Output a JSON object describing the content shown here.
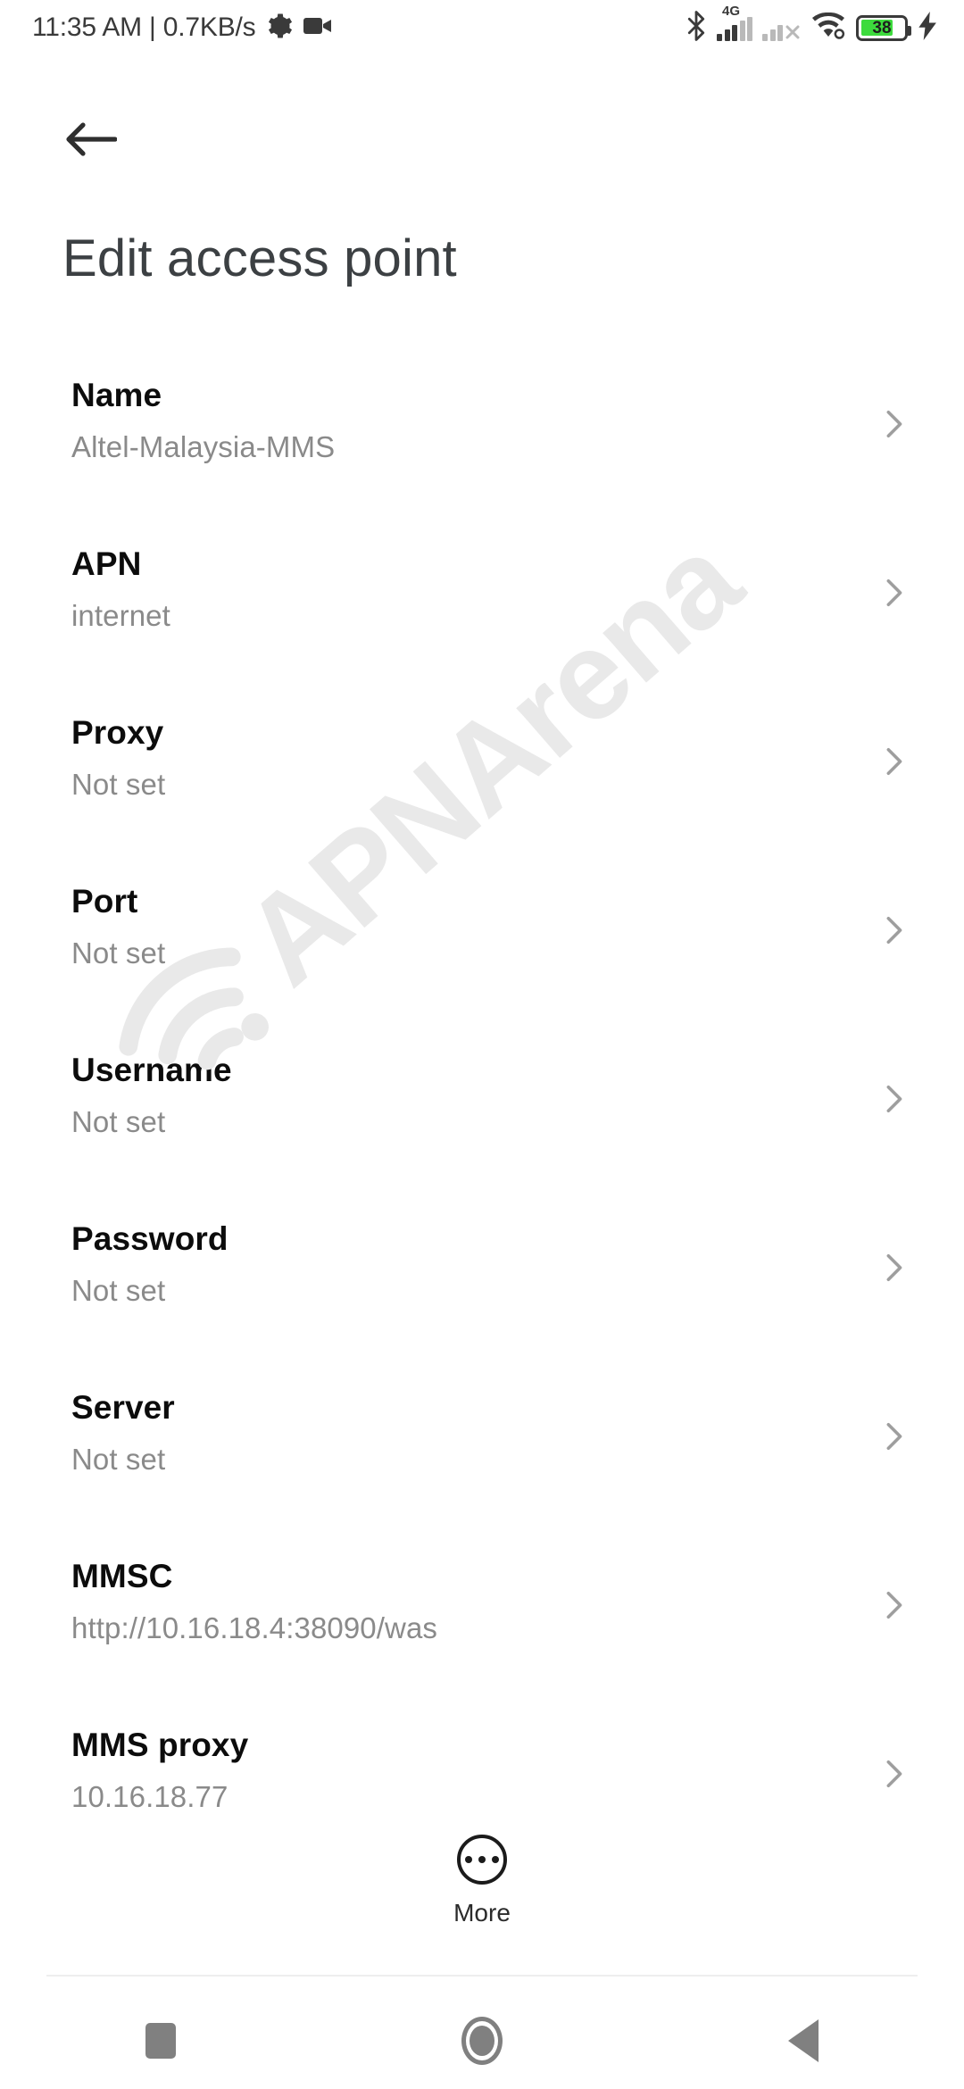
{
  "statusbar": {
    "time_and_speed": "11:35 AM | 0.7KB/s",
    "gear_icon": "gear-icon",
    "camera_icon": "video-camera-icon",
    "bluetooth_icon": "bluetooth-icon",
    "network_type": "4G",
    "sim1_icon": "signal-bars-sim1-icon",
    "sim2_icon": "signal-bars-sim2-no-service-icon",
    "wifi_icon": "wifi-icon",
    "battery_level": "38",
    "charging_icon": "charging-bolt-icon"
  },
  "header": {
    "back_icon": "arrow-back-icon",
    "title": "Edit access point"
  },
  "watermark": {
    "text": "APNArena",
    "icon": "wifi-signal-icon",
    "color": "#e9e9e9"
  },
  "list": {
    "chevron_icon": "chevron-right-icon",
    "rows": [
      {
        "label": "Name",
        "value": "Altel-Malaysia-MMS"
      },
      {
        "label": "APN",
        "value": "internet"
      },
      {
        "label": "Proxy",
        "value": "Not set"
      },
      {
        "label": "Port",
        "value": "Not set"
      },
      {
        "label": "Username",
        "value": "Not set"
      },
      {
        "label": "Password",
        "value": "Not set"
      },
      {
        "label": "Server",
        "value": "Not set"
      },
      {
        "label": "MMSC",
        "value": "http://10.16.18.4:38090/was"
      },
      {
        "label": "MMS proxy",
        "value": "10.16.18.77"
      }
    ]
  },
  "more_button": {
    "label": "More",
    "icon": "more-dots-circle-icon"
  },
  "navbar": {
    "recents_icon": "recents-square-icon",
    "home_icon": "home-circle-icon",
    "back_icon": "back-triangle-icon"
  },
  "colors": {
    "background": "#ffffff",
    "label_text": "#0c0c0c",
    "value_text": "#8a8a8a",
    "title_text": "#3c4043",
    "chevron": "#9e9e9e",
    "navbar_icon": "#808080",
    "battery_green": "#3ddb3d"
  }
}
